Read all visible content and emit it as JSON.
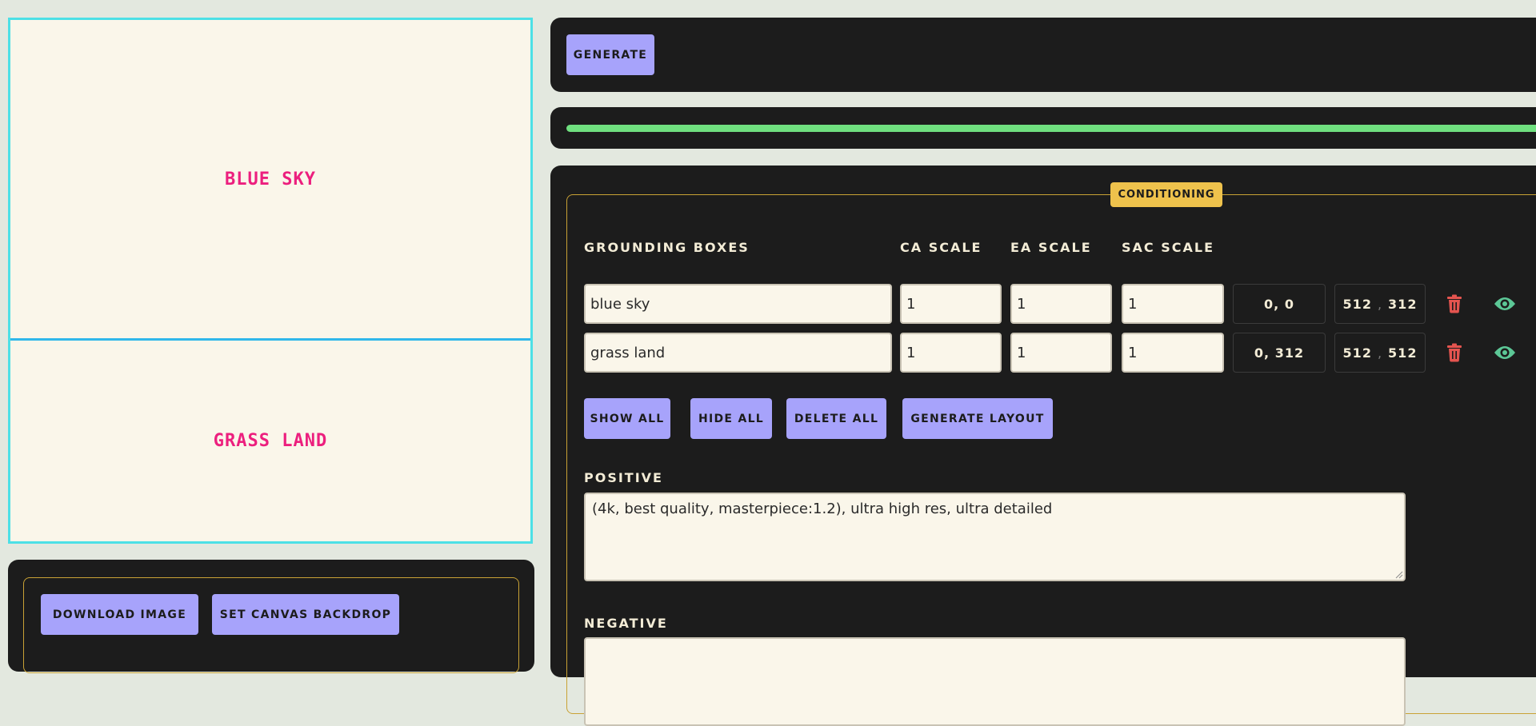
{
  "canvas": {
    "boxes": [
      {
        "label": "BLUE SKY"
      },
      {
        "label": "GRASS LAND"
      }
    ]
  },
  "download": {
    "download_label": "DOWNLOAD IMAGE",
    "backdrop_label": "SET CANVAS BACKDROP"
  },
  "generate": {
    "label": "GENERATE"
  },
  "progress": {
    "fraction": 1.0,
    "color": "#6fe07f"
  },
  "conditioning": {
    "badge": "CONDITIONING",
    "headers": {
      "grounding_boxes": "GROUNDING BOXES",
      "ca_scale": "CA SCALE",
      "ea_scale": "EA SCALE",
      "sac_scale": "SAC SCALE"
    },
    "rows": [
      {
        "prompt": "blue sky",
        "ca": "1",
        "ea": "1",
        "sac": "1",
        "start": "0, 0",
        "end_x": "512",
        "end_y": "312"
      },
      {
        "prompt": "grass land",
        "ca": "1",
        "ea": "1",
        "sac": "1",
        "start": "0, 312",
        "end_x": "512",
        "end_y": "512"
      }
    ],
    "actions": {
      "show_all": "SHOW ALL",
      "hide_all": "HIDE ALL",
      "delete_all": "DELETE ALL",
      "generate_layout": "GENERATE LAYOUT"
    },
    "positive_label": "POSITIVE",
    "positive_value": "(4k, best quality, masterpiece:1.2), ultra high res, ultra detailed",
    "negative_label": "NEGATIVE",
    "icons": {
      "delete": "trash-icon",
      "visibility": "eye-icon"
    },
    "colors": {
      "delete": "#e4544f",
      "visibility": "#5cc796",
      "accent": "#eec24c",
      "button": "#a7a3fb"
    }
  }
}
